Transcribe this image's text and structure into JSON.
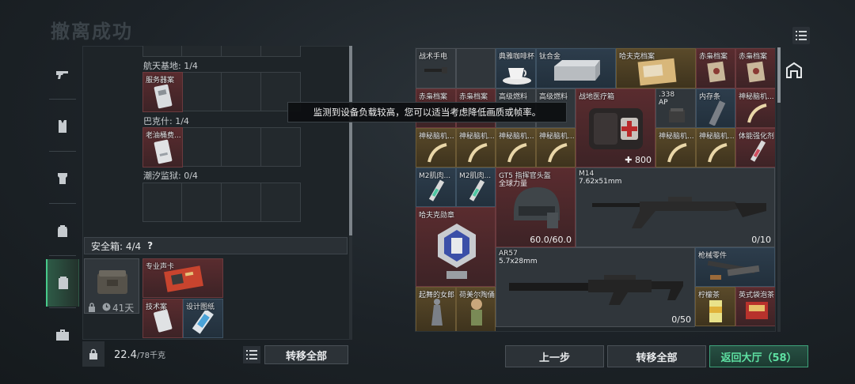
{
  "page_title": "撤离成功",
  "toast": "监测到设备负载较高，您可以适当考虑降低画质或帧率。",
  "left": {
    "locations": [
      {
        "label": "航天基地: 1/4",
        "item": "服务器案"
      },
      {
        "label": "巴克什: 1/4",
        "item": "老油桶费..."
      },
      {
        "label": "潮汐监狱: 0/4",
        "item": ""
      }
    ],
    "safe_box": {
      "label": "安全箱: 4/4",
      "help": "?",
      "duration": "41天",
      "items": [
        {
          "name": "专业声卡"
        },
        {
          "name": "技术案"
        },
        {
          "name": "设计图纸"
        }
      ]
    },
    "weight_current": "22.4",
    "weight_max": "/78千克",
    "transfer_all": "转移全部"
  },
  "right": {
    "items": [
      {
        "id": "r1",
        "name": "战术手电"
      },
      {
        "id": "r2",
        "name": "典雅咖啡杯"
      },
      {
        "id": "r3",
        "name": "钛合金"
      },
      {
        "id": "r4",
        "name": "哈夫克档案"
      },
      {
        "id": "r5",
        "name": "赤枭档案"
      },
      {
        "id": "r6",
        "name": "赤枭档案"
      },
      {
        "id": "r7",
        "name": "赤枭档案"
      },
      {
        "id": "r8",
        "name": "赤枭档案"
      },
      {
        "id": "r9",
        "name": "高级燃料"
      },
      {
        "id": "r10",
        "name": "高级燃料"
      },
      {
        "id": "r11",
        "name": "战地医疗箱",
        "value": "800"
      },
      {
        "id": "r12",
        "name": ".338",
        "sub": "AP"
      },
      {
        "id": "r13",
        "name": "内存条"
      },
      {
        "id": "r14",
        "name": "神秘脑机..."
      },
      {
        "id": "r15",
        "name": "神秘脑机..."
      },
      {
        "id": "r16",
        "name": "神秘脑机..."
      },
      {
        "id": "r17",
        "name": "神秘脑机..."
      },
      {
        "id": "r18",
        "name": "神秘脑机..."
      },
      {
        "id": "r19",
        "name": "神秘脑机..."
      },
      {
        "id": "r20",
        "name": "神秘脑机..."
      },
      {
        "id": "r21",
        "name": "体能强化剂"
      },
      {
        "id": "r22",
        "name": "M2肌肉..."
      },
      {
        "id": "r23",
        "name": "M2肌肉..."
      },
      {
        "id": "r24",
        "name": "GT5 指挥官头盔",
        "sub": "全球力量",
        "value": "60.0/60.0"
      },
      {
        "id": "r25",
        "name": "M14",
        "sub": "7.62x51mm",
        "value": "0/10"
      },
      {
        "id": "r26",
        "name": "哈夫克勋章"
      },
      {
        "id": "r27",
        "name": "AR57",
        "sub": "5.7x28mm",
        "value": "0/50"
      },
      {
        "id": "r28",
        "name": "枪械零件"
      },
      {
        "id": "r29",
        "name": "柠檬茶"
      },
      {
        "id": "r30",
        "name": "英式袋泡茶"
      },
      {
        "id": "r31",
        "name": "起舞的女郎"
      },
      {
        "id": "r32",
        "name": "荷美尔陶俑"
      }
    ]
  },
  "footer": {
    "prev": "上一步",
    "transfer_all": "转移全部",
    "back_lobby": "返回大厅（58）"
  },
  "colors": {
    "accent_green": "#47c98a",
    "item_red": "#5a2c2f",
    "item_gold": "#5a4a2a"
  },
  "icons": [
    "pistol-icon",
    "vest-icon",
    "armor-icon",
    "backpack-icon",
    "safe-box-icon",
    "briefcase-icon",
    "list-icon",
    "lock-icon",
    "clock-icon",
    "storage-icon"
  ]
}
